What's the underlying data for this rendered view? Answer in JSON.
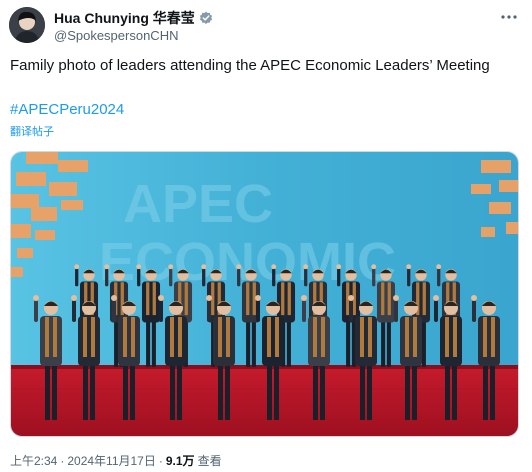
{
  "author": {
    "display_name": "Hua Chunying 华春莹",
    "handle": "@SpokespersonCHN"
  },
  "tweet": {
    "text": "Family photo of leaders attending the APEC Economic Leaders’ Meeting",
    "hashtag": "#APECPeru2024",
    "translate_label": "翻译帖子"
  },
  "photo": {
    "backdrop_lines": [
      "APEC",
      "ECONOMIC"
    ],
    "backdrop_color": "#45b3d6",
    "carpet_color": "#c8102e"
  },
  "meta": {
    "time": "上午2:34",
    "separator": "·",
    "date": "2024年11月17日",
    "views_count": "9.1万",
    "views_label": "查看"
  },
  "icons": {
    "verified": "verified-badge-icon",
    "more": "more-options-icon"
  },
  "colors": {
    "link": "#1d9bf0",
    "secondary_text": "#536471",
    "primary_text": "#0f1419"
  }
}
